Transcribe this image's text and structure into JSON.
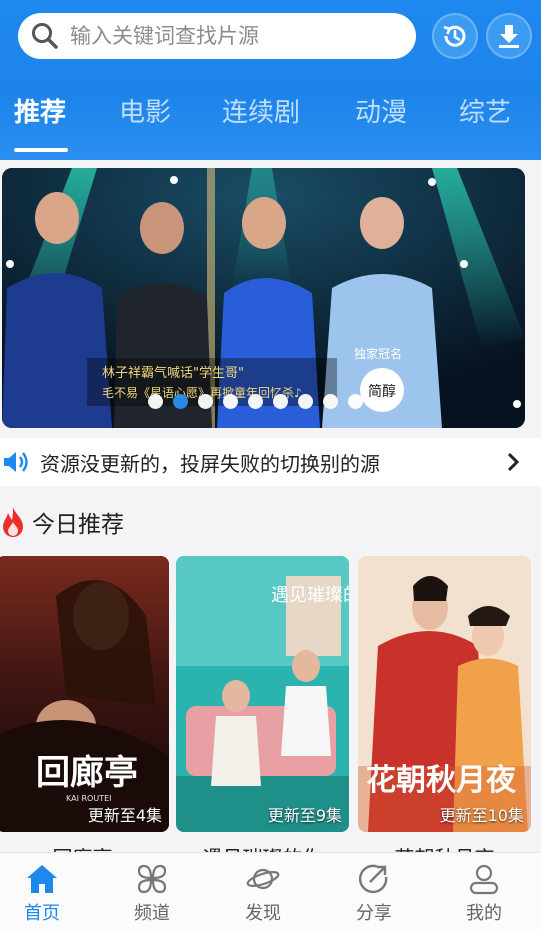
{
  "search": {
    "placeholder": "输入关键词查找片源"
  },
  "header_icons": [
    "history-icon",
    "download-icon"
  ],
  "tabs": [
    {
      "label": "推荐",
      "active": true
    },
    {
      "label": "电影"
    },
    {
      "label": "连续剧"
    },
    {
      "label": "动漫"
    },
    {
      "label": "综艺"
    }
  ],
  "banner": {
    "caption_line1": "林子祥霸气喊话\"学生哥\"",
    "caption_line2": "毛不易《星语心愿》再掀童年回忆杀♪",
    "sponsor": "独家冠名",
    "logo_text": "简醇",
    "dot_count": 9,
    "active_dot": 1
  },
  "notice": {
    "text": "资源没更新的，投屏失败的切换别的源"
  },
  "section": {
    "title": "今日推荐"
  },
  "cards": [
    {
      "title": "回廊亭",
      "episodes": "更新至4集",
      "poster_text": "回廊亭",
      "poster_sub": "KAI ROUTEI"
    },
    {
      "title": "遇见璀璨的你",
      "episodes": "更新至9集",
      "poster_text": "遇见璀璨的你"
    },
    {
      "title": "花朝秋月夜",
      "episodes": "更新至10集",
      "poster_text": "花朝秋月夜"
    }
  ],
  "tabbar": [
    {
      "label": "首页",
      "icon": "home-icon",
      "active": true
    },
    {
      "label": "频道",
      "icon": "channel-icon"
    },
    {
      "label": "发现",
      "icon": "discover-icon"
    },
    {
      "label": "分享",
      "icon": "share-icon"
    },
    {
      "label": "我的",
      "icon": "profile-icon"
    }
  ],
  "colors": {
    "accent": "#1e88ee",
    "header": "#1d84ea"
  }
}
